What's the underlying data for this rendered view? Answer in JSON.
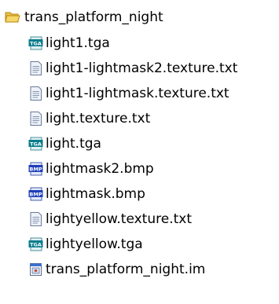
{
  "folder": {
    "name": "trans_platform_night",
    "icon": "folder-open-icon"
  },
  "files": [
    {
      "name": "light1.tga",
      "icon": "tga-file-icon"
    },
    {
      "name": "light1-lightmask2.texture.txt",
      "icon": "text-file-icon"
    },
    {
      "name": "light1-lightmask.texture.txt",
      "icon": "text-file-icon"
    },
    {
      "name": "light.texture.txt",
      "icon": "text-file-icon"
    },
    {
      "name": "light.tga",
      "icon": "tga-file-icon"
    },
    {
      "name": "lightmask2.bmp",
      "icon": "bmp-file-icon"
    },
    {
      "name": "lightmask.bmp",
      "icon": "bmp-file-icon"
    },
    {
      "name": "lightyellow.texture.txt",
      "icon": "text-file-icon"
    },
    {
      "name": "lightyellow.tga",
      "icon": "tga-file-icon"
    },
    {
      "name": "trans_platform_night.im",
      "icon": "im-file-icon"
    }
  ],
  "icon_labels": {
    "tga": "TGA",
    "bmp": "BMP"
  },
  "colors": {
    "folder_fill": "#f5d76a",
    "folder_stroke": "#b8860b",
    "tga_badge": "#0a7c8c",
    "bmp_badge": "#1f3fb8",
    "text_file_fill": "#eef2f8",
    "text_file_stroke": "#6a7a99"
  }
}
